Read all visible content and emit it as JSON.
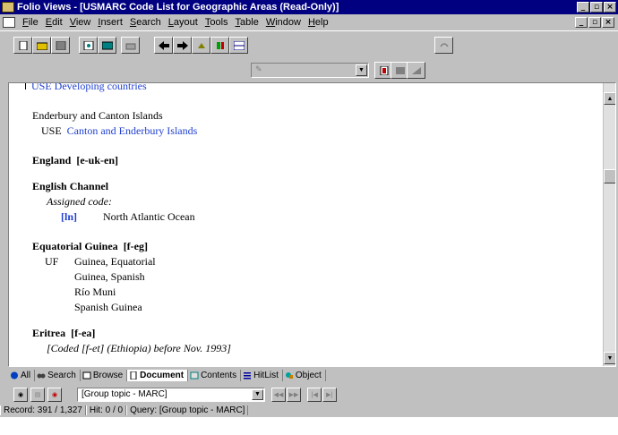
{
  "window": {
    "title": "Folio Views - [USMARC Code List for Geographic Areas  (Read-Only)]"
  },
  "menubar": {
    "items": [
      "File",
      "Edit",
      "View",
      "Insert",
      "Search",
      "Layout",
      "Tools",
      "Table",
      "Window",
      "Help"
    ]
  },
  "document": {
    "top_partial": "USE  Developing countries",
    "entries": [
      {
        "heading": "Enderbury and Canton Islands",
        "use_label": "USE",
        "use_link": "Canton and Enderbury Islands"
      },
      {
        "heading": "England",
        "code": "[e-uk-en]"
      },
      {
        "heading": "English Channel",
        "assigned_label": "Assigned code:",
        "assigned_code": "[ln]",
        "assigned_name": "North Atlantic Ocean"
      },
      {
        "heading": "Equatorial Guinea",
        "code": "[f-eg]",
        "uf_label": "UF",
        "uf_items": [
          "Guinea, Equatorial",
          "Guinea, Spanish",
          "Río Muni",
          "Spanish Guinea"
        ]
      },
      {
        "heading": "Eritrea",
        "code": "[f-ea]",
        "note": "[Coded [f-et] (Ethiopia) before Nov. 1993]"
      }
    ]
  },
  "tabs": [
    {
      "label": "All",
      "icon": "globe-icon"
    },
    {
      "label": "Search",
      "icon": "binoculars-icon"
    },
    {
      "label": "Browse",
      "icon": "browse-icon"
    },
    {
      "label": "Document",
      "icon": "document-icon",
      "active": true
    },
    {
      "label": "Contents",
      "icon": "contents-icon"
    },
    {
      "label": "HitList",
      "icon": "hitlist-icon"
    },
    {
      "label": "Object",
      "icon": "object-icon"
    }
  ],
  "bottombar": {
    "group_select_value": "[Group topic - MARC]"
  },
  "status": {
    "record": "Record: 391 / 1,327",
    "hit": "Hit: 0 / 0",
    "query": "Query: [Group topic - MARC]"
  },
  "colors": {
    "titlebar": "#000080",
    "link": "#1f3fd0",
    "chrome": "#c0c0c0"
  }
}
